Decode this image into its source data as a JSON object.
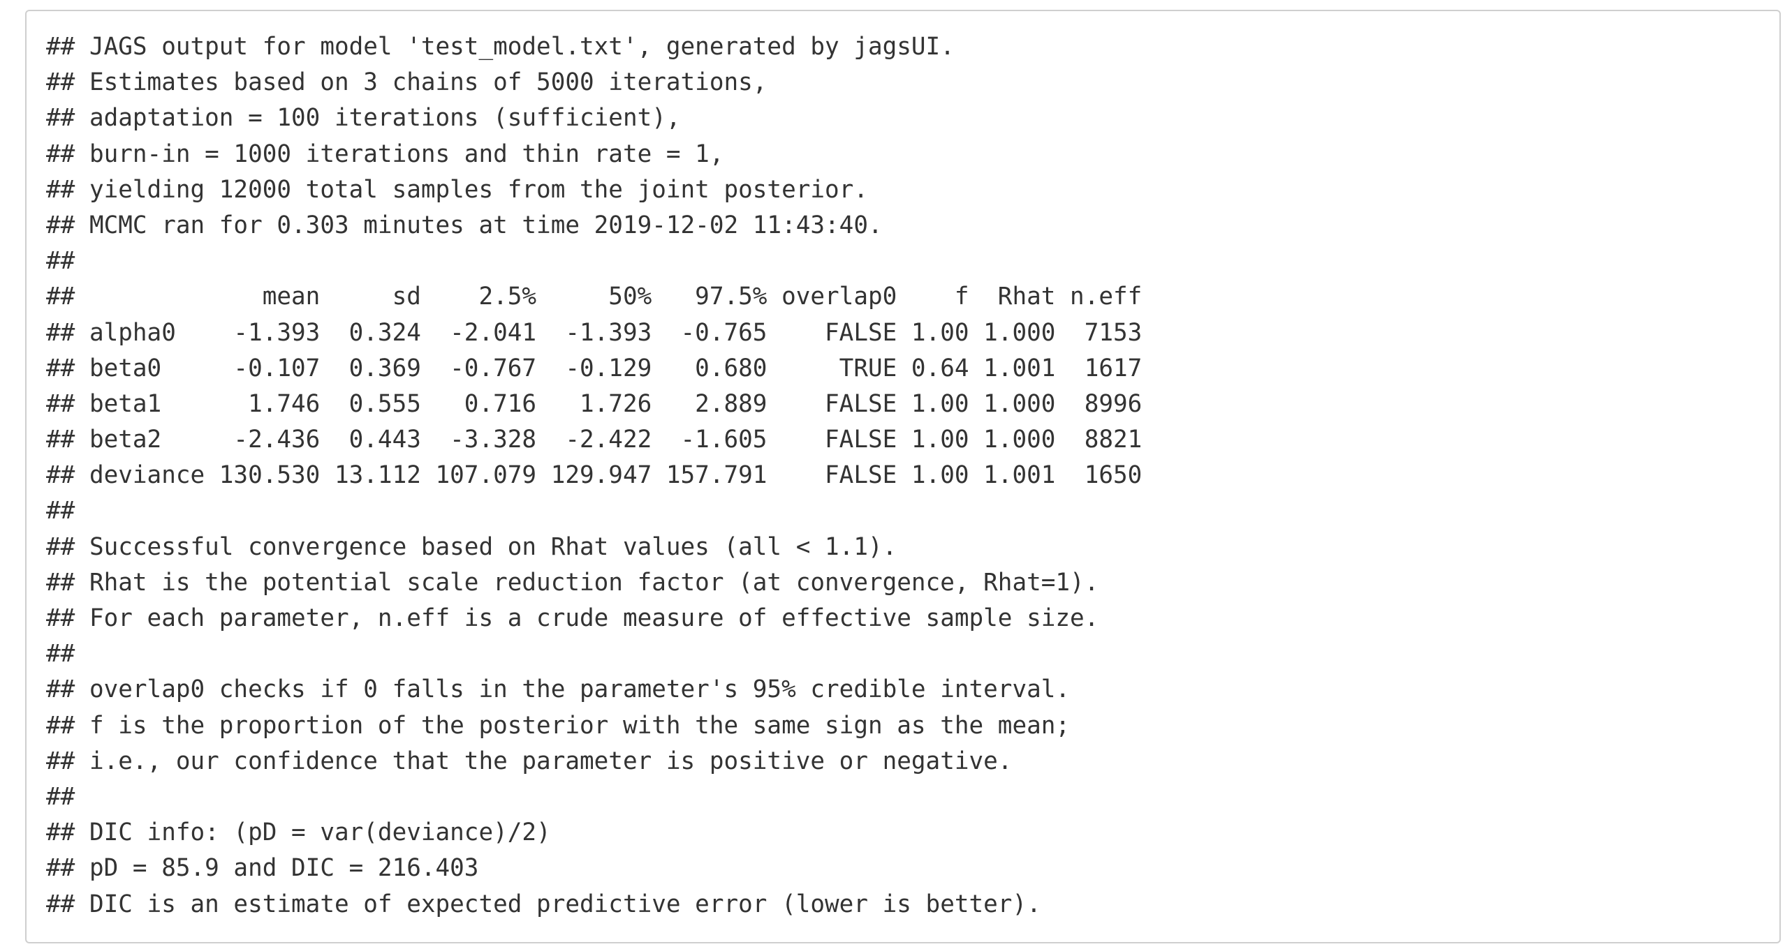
{
  "output": {
    "lines": [
      "## JAGS output for model 'test_model.txt', generated by jagsUI.",
      "## Estimates based on 3 chains of 5000 iterations,",
      "## adaptation = 100 iterations (sufficient),",
      "## burn-in = 1000 iterations and thin rate = 1,",
      "## yielding 12000 total samples from the joint posterior.",
      "## MCMC ran for 0.303 minutes at time 2019-12-02 11:43:40.",
      "##",
      "##             mean     sd    2.5%     50%   97.5% overlap0    f  Rhat n.eff",
      "## alpha0    -1.393  0.324  -2.041  -1.393  -0.765    FALSE 1.00 1.000  7153",
      "## beta0     -0.107  0.369  -0.767  -0.129   0.680     TRUE 0.64 1.001  1617",
      "## beta1      1.746  0.555   0.716   1.726   2.889    FALSE 1.00 1.000  8996",
      "## beta2     -2.436  0.443  -3.328  -2.422  -1.605    FALSE 1.00 1.000  8821",
      "## deviance 130.530 13.112 107.079 129.947 157.791    FALSE 1.00 1.001  1650",
      "##",
      "## Successful convergence based on Rhat values (all < 1.1).",
      "## Rhat is the potential scale reduction factor (at convergence, Rhat=1).",
      "## For each parameter, n.eff is a crude measure of effective sample size.",
      "##",
      "## overlap0 checks if 0 falls in the parameter's 95% credible interval.",
      "## f is the proportion of the posterior with the same sign as the mean;",
      "## i.e., our confidence that the parameter is positive or negative.",
      "##",
      "## DIC info: (pD = var(deviance)/2)",
      "## pD = 85.9 and DIC = 216.403",
      "## DIC is an estimate of expected predictive error (lower is better)."
    ]
  }
}
